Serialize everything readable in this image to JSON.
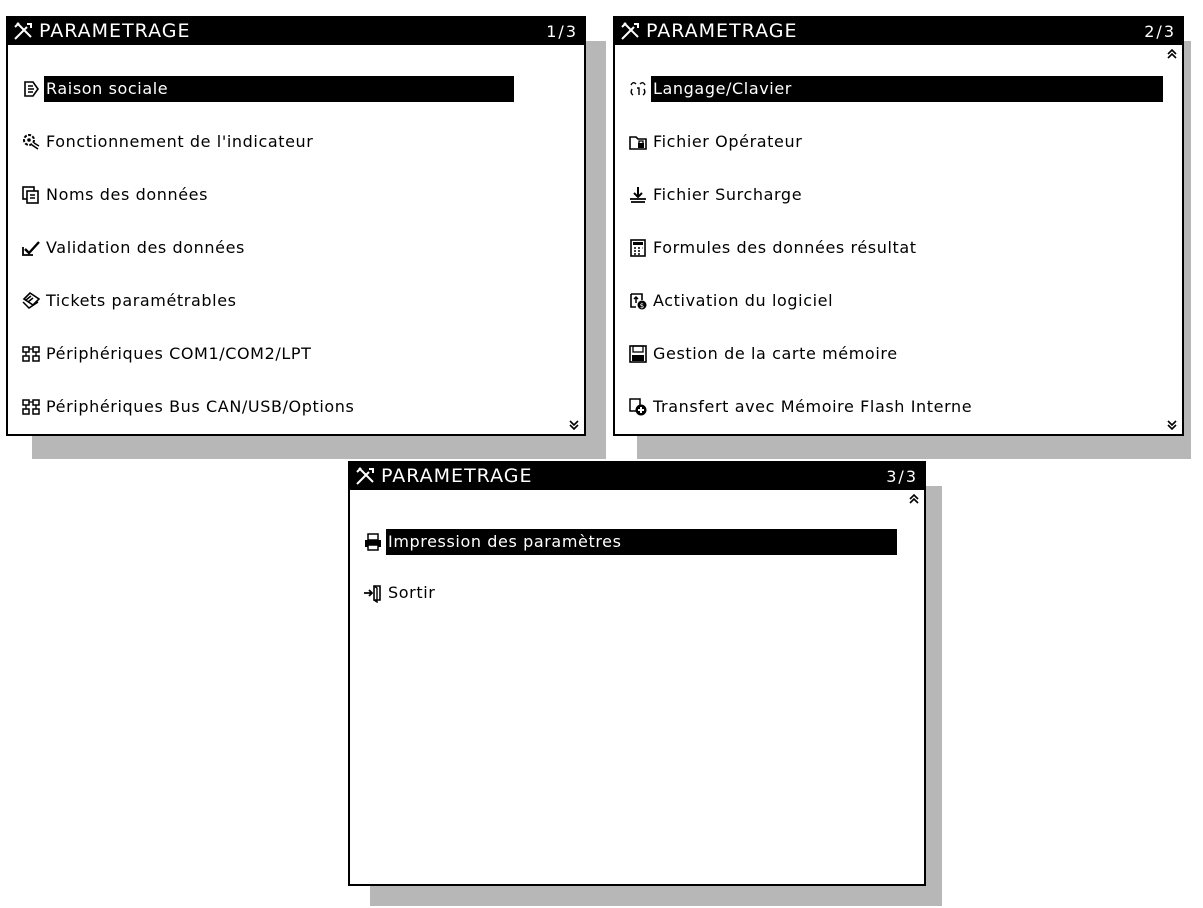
{
  "colors": {
    "foreground": "#000000",
    "background": "#ffffff",
    "shadow": "#b7b7b7"
  },
  "panels": [
    {
      "title": "PARAMETRAGE",
      "page": "1/3",
      "scroll_up": false,
      "scroll_down": true,
      "items": [
        {
          "label": "Raison sociale",
          "icon": "company-icon",
          "selected": true
        },
        {
          "label": "Fonctionnement de l'indicateur",
          "icon": "gear-icon",
          "selected": false
        },
        {
          "label": "Noms des données",
          "icon": "names-icon",
          "selected": false
        },
        {
          "label": "Validation des données",
          "icon": "checkmark-icon",
          "selected": false
        },
        {
          "label": "Tickets paramétrables",
          "icon": "ticket-icon",
          "selected": false
        },
        {
          "label": "Périphériques COM1/COM2/LPT",
          "icon": "peripherals-icon",
          "selected": false
        },
        {
          "label": "Périphériques Bus CAN/USB/Options",
          "icon": "peripherals-icon",
          "selected": false
        }
      ]
    },
    {
      "title": "PARAMETRAGE",
      "page": "2/3",
      "scroll_up": true,
      "scroll_down": true,
      "items": [
        {
          "label": "Langage/Clavier",
          "icon": "language-icon",
          "selected": true
        },
        {
          "label": "Fichier Opérateur",
          "icon": "operator-file-icon",
          "selected": false
        },
        {
          "label": "Fichier Surcharge",
          "icon": "overload-file-icon",
          "selected": false
        },
        {
          "label": "Formules des données résultat",
          "icon": "calculator-icon",
          "selected": false
        },
        {
          "label": "Activation du logiciel",
          "icon": "activation-icon",
          "selected": false
        },
        {
          "label": "Gestion de la carte mémoire",
          "icon": "memory-card-icon",
          "selected": false
        },
        {
          "label": "Transfert avec Mémoire Flash Interne",
          "icon": "flash-transfer-icon",
          "selected": false
        }
      ]
    },
    {
      "title": "PARAMETRAGE",
      "page": "3/3",
      "scroll_up": true,
      "scroll_down": false,
      "items": [
        {
          "label": "Impression des paramètres",
          "icon": "printer-icon",
          "selected": true
        },
        {
          "label": "Sortir",
          "icon": "exit-icon",
          "selected": false
        }
      ]
    }
  ]
}
